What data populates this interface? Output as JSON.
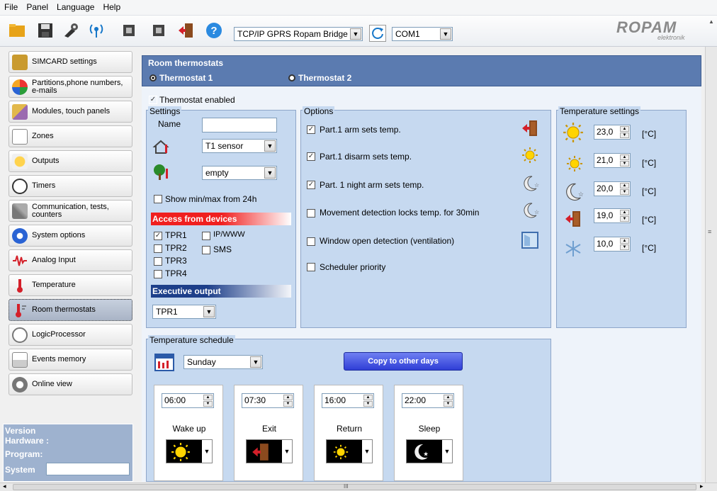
{
  "menu": [
    "File",
    "Panel",
    "Language",
    "Help"
  ],
  "toolbar": {
    "connection": "TCP/IP GPRS Ropam Bridge",
    "port": "COM1",
    "logo_main": "ROPAM",
    "logo_sub": "elektronik"
  },
  "sidebar": {
    "items": [
      {
        "label": "SIMCARD settings"
      },
      {
        "label": "Partitions,phone numbers, e-mails"
      },
      {
        "label": "Modules, touch panels"
      },
      {
        "label": "Zones"
      },
      {
        "label": "Outputs"
      },
      {
        "label": "Timers"
      },
      {
        "label": "Communication, tests, counters"
      },
      {
        "label": "System options"
      },
      {
        "label": "Analog Input"
      },
      {
        "label": "Temperature"
      },
      {
        "label": "Room thermostats"
      },
      {
        "label": "LogicProcessor"
      },
      {
        "label": "Events memory"
      },
      {
        "label": "Online view"
      }
    ],
    "version": {
      "title": "Version",
      "hardware": "Hardware :",
      "program": "Program:",
      "system": "System"
    }
  },
  "room": {
    "title": "Room thermostats",
    "thermostat1": "Thermostat 1",
    "thermostat2": "Thermostat 2",
    "enabled_label": "Thermostat enabled"
  },
  "settings": {
    "title": "Settings",
    "name_label": "Name",
    "name_value": "",
    "sensor": "T1 sensor",
    "outdoor": "empty",
    "minmax": "Show min/max from 24h",
    "access_title": "Access from devices",
    "devices": [
      "TPR1",
      "TPR2",
      "TPR3",
      "TPR4",
      "IP/WWW",
      "SMS"
    ],
    "exec_title": "Executive output",
    "exec_value": "TPR1"
  },
  "options": {
    "title": "Options",
    "items": [
      {
        "label": "Part.1 arm sets temp.",
        "checked": true
      },
      {
        "label": "Part.1 disarm sets temp.",
        "checked": true
      },
      {
        "label": "Part. 1 night arm sets temp.",
        "checked": true
      },
      {
        "label": "Movement detection locks temp. for 30min",
        "checked": false
      },
      {
        "label": "Window open detection (ventilation)",
        "checked": false
      },
      {
        "label": "Scheduler priority",
        "checked": false
      }
    ]
  },
  "temp_settings": {
    "title": "Temperature settings",
    "values": [
      "23,0",
      "21,0",
      "20,0",
      "19,0",
      "10,0"
    ],
    "unit": "[°C]"
  },
  "schedule": {
    "title": "Temperature schedule",
    "day": "Sunday",
    "copy_button": "Copy to other days",
    "slots": [
      {
        "time": "06:00",
        "label": "Wake up",
        "icon": "sun-icon"
      },
      {
        "time": "07:30",
        "label": "Exit",
        "icon": "door-exit-icon"
      },
      {
        "time": "16:00",
        "label": "Return",
        "icon": "small-sun-icon"
      },
      {
        "time": "22:00",
        "label": "Sleep",
        "icon": "moon-icon"
      }
    ]
  },
  "statusbar": {
    "scroll_marker": "III"
  }
}
